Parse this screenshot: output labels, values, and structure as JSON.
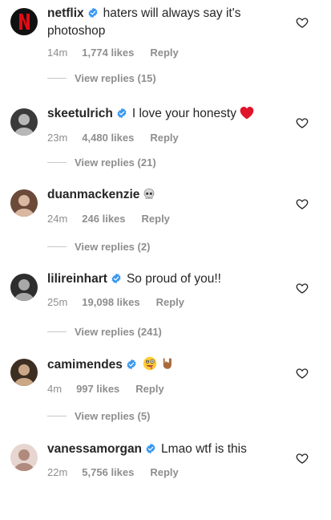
{
  "comments": [
    {
      "username": "netflix",
      "verified": true,
      "text": "haters will always say it's photoshop",
      "time": "14m",
      "likes": "1,774 likes",
      "reply_label": "Reply",
      "view_replies": "View replies (15)",
      "avatar_colors": [
        "#111111",
        "#e50914"
      ]
    },
    {
      "username": "skeetulrich",
      "verified": true,
      "text": "I love your honesty",
      "emoji": "red-heart-emoji",
      "time": "23m",
      "likes": "4,480 likes",
      "reply_label": "Reply",
      "view_replies": "View replies (21)",
      "avatar_colors": [
        "#3a3a3a",
        "#b7b7b7"
      ]
    },
    {
      "username": "duanmackenzie",
      "verified": false,
      "text": "",
      "emoji": "skull-emoji",
      "time": "24m",
      "likes": "246 likes",
      "reply_label": "Reply",
      "view_replies": "View replies (2)",
      "avatar_colors": [
        "#6b4a3a",
        "#d9b7a0"
      ]
    },
    {
      "username": "lilireinhart",
      "verified": true,
      "text": "So proud of you!!",
      "time": "25m",
      "likes": "19,098 likes",
      "reply_label": "Reply",
      "view_replies": "View replies (241)",
      "avatar_colors": [
        "#2e2e2e",
        "#a8a8a8"
      ]
    },
    {
      "username": "camimendes",
      "verified": true,
      "text": "",
      "emoji": "zany-face-emoji + horns-hand-emoji",
      "time": "4m",
      "likes": "997 likes",
      "reply_label": "Reply",
      "view_replies": "View replies (5)",
      "avatar_colors": [
        "#3d2e22",
        "#c9a787"
      ]
    },
    {
      "username": "vanessamorgan",
      "verified": true,
      "text": "Lmao wtf is this",
      "time": "22m",
      "likes": "5,756 likes",
      "reply_label": "Reply",
      "view_replies": "",
      "avatar_colors": [
        "#e6d6cf",
        "#b08a7c"
      ]
    }
  ],
  "colors": {
    "text": "#262626",
    "secondary": "#8e8e8e",
    "verified_blue": "#3897f0",
    "heart_outline": "#262626"
  },
  "icons": {
    "verified": "verified-badge-icon",
    "like": "heart-outline-icon"
  }
}
